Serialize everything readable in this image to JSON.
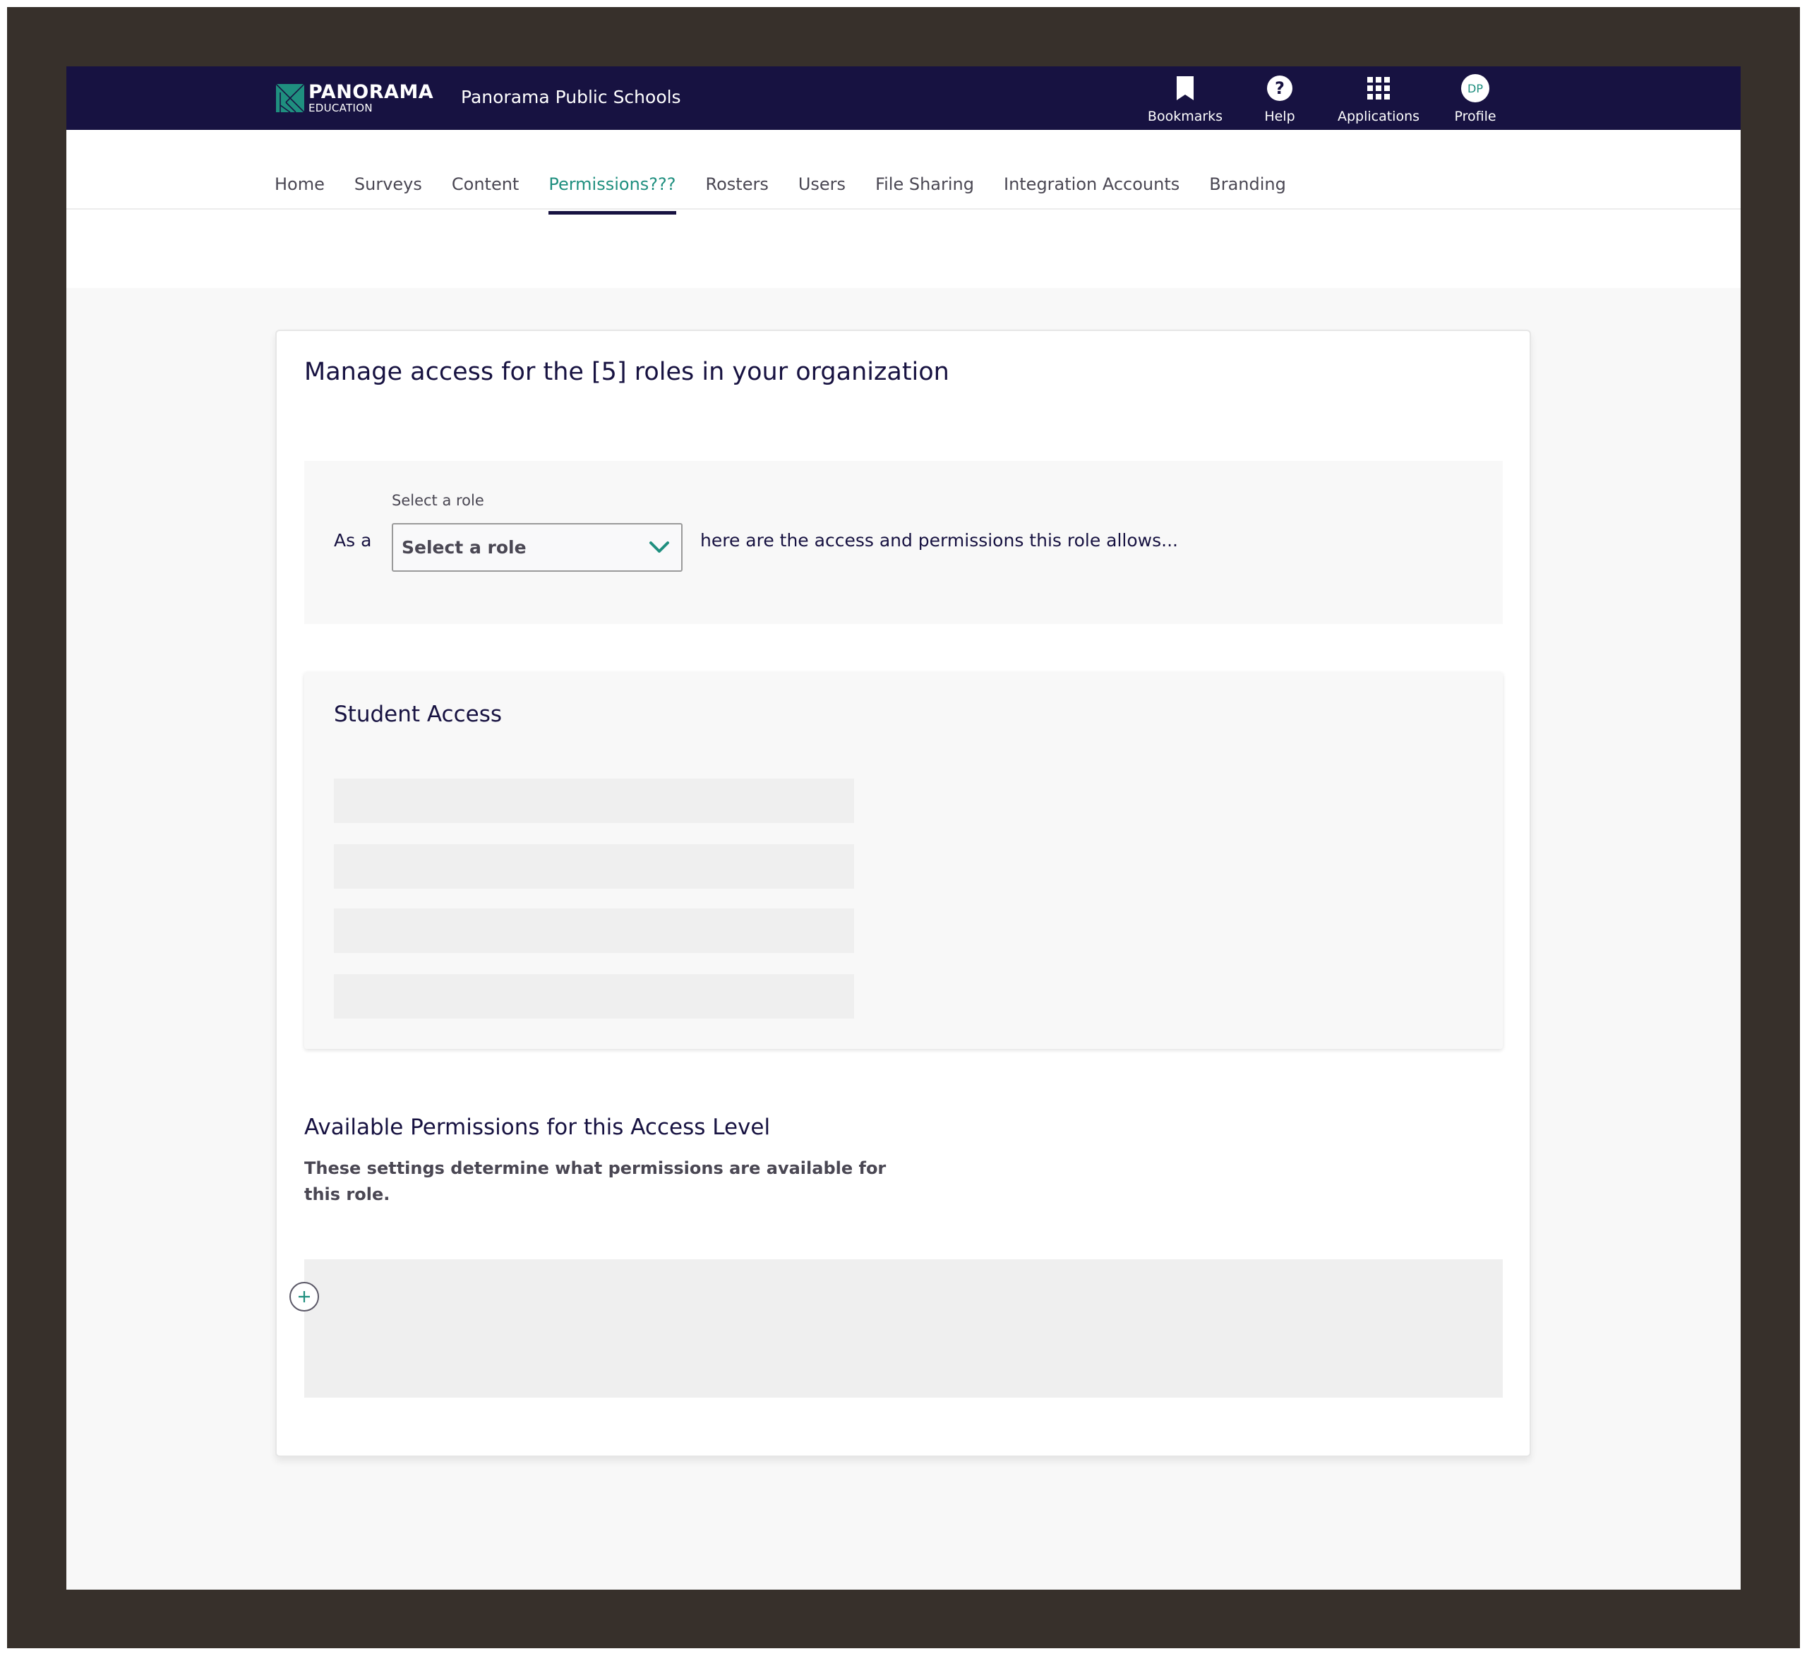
{
  "header": {
    "logo": {
      "name": "PANORAMA",
      "subtitle": "EDUCATION",
      "icon": "panorama-logo-icon"
    },
    "org_name": "Panorama Public Schools",
    "nav": [
      {
        "label": "Bookmarks",
        "icon": "bookmark-icon"
      },
      {
        "label": "Help",
        "icon": "help-icon"
      },
      {
        "label": "Applications",
        "icon": "apps-grid-icon"
      },
      {
        "label": "Profile",
        "icon": "avatar",
        "initials": "DP"
      }
    ]
  },
  "tabs": [
    {
      "label": "Home",
      "active": false
    },
    {
      "label": "Surveys",
      "active": false
    },
    {
      "label": "Content",
      "active": false
    },
    {
      "label": "Permissions???",
      "active": true
    },
    {
      "label": "Rosters",
      "active": false
    },
    {
      "label": "Users",
      "active": false
    },
    {
      "label": "File Sharing",
      "active": false
    },
    {
      "label": "Integration Accounts",
      "active": false
    },
    {
      "label": "Branding",
      "active": false
    }
  ],
  "card": {
    "title": "Manage access for the [5] roles in your organization",
    "role_selector": {
      "prefix": "As a",
      "label": "Select a role",
      "value": "Select a role",
      "suffix": "here are the access and permissions this role allows..."
    },
    "student_access": {
      "title": "Student Access",
      "skeleton_rows": 4
    },
    "available_permissions": {
      "title": "Available Permissions for this Access Level",
      "description": "These settings determine what permissions are available for this role."
    }
  },
  "colors": {
    "header_bg": "#171241",
    "accent": "#1f8f7f",
    "text_dark": "#171241",
    "text_muted": "#4a4753",
    "frame": "#37302b"
  }
}
